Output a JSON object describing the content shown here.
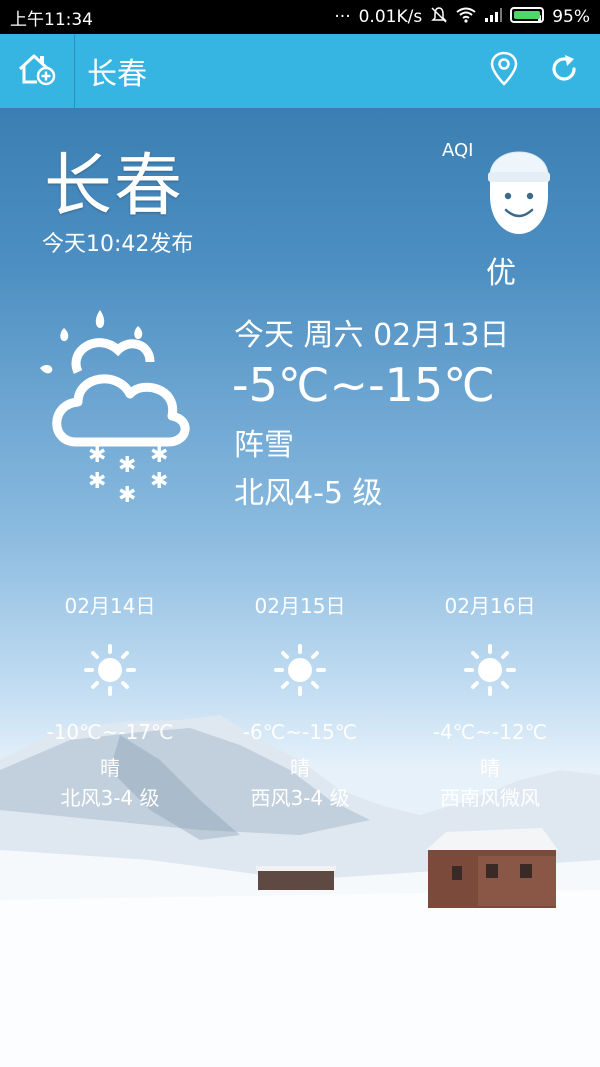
{
  "status_bar": {
    "time": "上午11:34",
    "network_speed": "0.01K/s",
    "battery": "95%",
    "battery_color": "#4CD964"
  },
  "toolbar": {
    "title": "长春",
    "background": "#36b4e2",
    "icons": [
      "home-add-icon",
      "location-pin-icon",
      "refresh-icon"
    ]
  },
  "current": {
    "city": "长春",
    "publish_time": "今天10:42发布",
    "aqi_label": "AQI",
    "aqi_level": "优"
  },
  "today": {
    "date": "今天 周六 02月13日",
    "temp": "-5℃~-15℃",
    "condition": "阵雪",
    "wind": "北风4-5 级",
    "icon": "snow-shower-icon"
  },
  "forecast": [
    {
      "date": "02月14日",
      "temp": "-10℃~-17℃",
      "condition": "晴",
      "wind": "北风3-4 级",
      "icon": "sun-icon"
    },
    {
      "date": "02月15日",
      "temp": "-6℃~-15℃",
      "condition": "晴",
      "wind": "西风3-4 级",
      "icon": "sun-icon"
    },
    {
      "date": "02月16日",
      "temp": "-4℃~-12℃",
      "condition": "晴",
      "wind": "西南风微风",
      "icon": "sun-icon"
    }
  ]
}
